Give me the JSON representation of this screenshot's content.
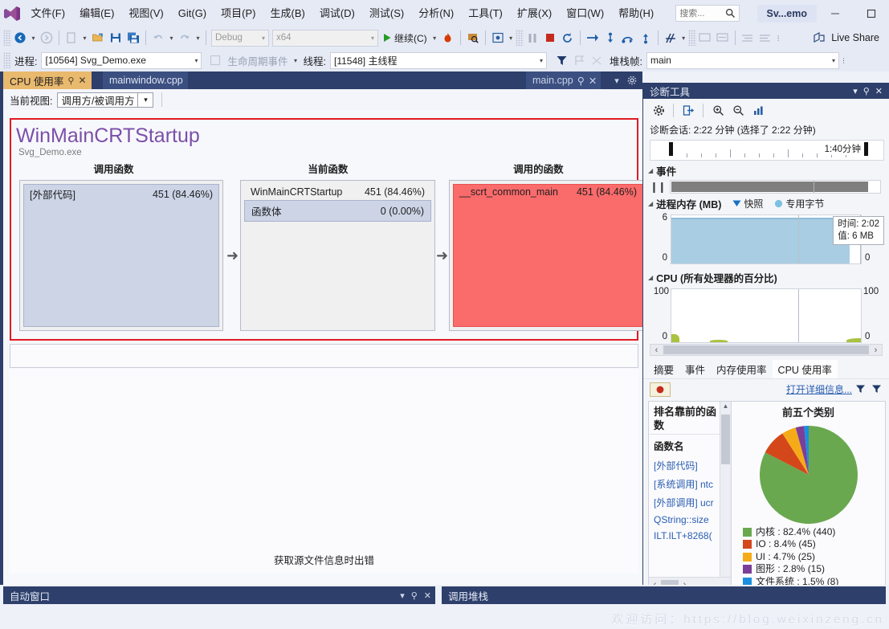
{
  "menu": {
    "logo_icon": "visual-studio-logo",
    "items": [
      "文件(F)",
      "编辑(E)",
      "视图(V)",
      "Git(G)",
      "项目(P)",
      "生成(B)",
      "调试(D)",
      "测试(S)",
      "分析(N)",
      "工具(T)",
      "扩展(X)",
      "窗口(W)",
      "帮助(H)"
    ],
    "search_placeholder": "搜索...",
    "search_value": "",
    "search_icon": "search-icon",
    "window_title": "Sv...emo",
    "minimize_icon": "minimize-icon",
    "maximize_icon": "maximize-icon"
  },
  "toolbar": {
    "nav_back_icon": "navigate-back-icon",
    "nav_forward_icon": "navigate-forward-icon",
    "new_item_icon": "new-item-icon",
    "open_icon": "open-file-icon",
    "save_icon": "save-icon",
    "save_all_icon": "save-all-icon",
    "undo_icon": "undo-icon",
    "redo_icon": "redo-icon",
    "config_value": "Debug",
    "platform_value": "x64",
    "continue_label": "继续(C)",
    "continue_icon": "play-icon",
    "hot_reload_icon": "hot-reload-icon",
    "attach_icon": "attach-to-process-icon",
    "break_all_icon": "break-all-icon",
    "pause_icon": "pause-icon",
    "stop_icon": "stop-debugging-icon",
    "restart_icon": "restart-icon",
    "show_next_icon": "show-next-statement-icon",
    "step_into_icon": "step-into-icon",
    "step_over_icon": "step-over-icon",
    "step_out_icon": "step-out-icon",
    "thread_icon": "threads-icon",
    "live_share_label": "Live Share",
    "live_share_icon": "live-share-icon"
  },
  "debugbar": {
    "process_label": "进程:",
    "process_value": "[10564] Svg_Demo.exe",
    "lifecycle_label": "生命周期事件",
    "lifecycle_icon": "lifecycle-events-icon",
    "thread_label": "线程:",
    "thread_value": "[11548] 主线程",
    "filter_icon": "filter-icon",
    "flag_icon": "flag-icon",
    "nocall_icon": "no-call-icon",
    "stackframe_label": "堆栈帧:",
    "stackframe_value": "main"
  },
  "doc_tabs": {
    "active": {
      "label": "CPU 使用率",
      "pin_icon": "pin-icon",
      "close_icon": "close-icon"
    },
    "inactive": {
      "label": "mainwindow.cpp"
    },
    "right": {
      "label": "main.cpp",
      "preview_icon": "preview-icon",
      "close_icon": "close-icon",
      "dropdown_icon": "chevron-down-icon",
      "settings_icon": "gear-icon"
    }
  },
  "viewbar": {
    "label": "当前视图:",
    "value": "调用方/被调用方",
    "dropdown_icon": "chevron-down-icon"
  },
  "calltree": {
    "title": "WinMainCRTStartup",
    "subtitle": "Svg_Demo.exe",
    "columns": [
      "调用函数",
      "当前函数",
      "调用的函数"
    ],
    "accent_color": "#e01b24",
    "callers": [
      {
        "name": "[外部代码]",
        "value": "451 (84.46%)"
      }
    ],
    "current": [
      {
        "name": "WinMainCRTStartup",
        "value": "451 (84.46%)"
      },
      {
        "name": "函数体",
        "value": "0 (0.00%)"
      }
    ],
    "callees": [
      {
        "name": "__scrt_common_main",
        "value": "451 (84.46%)"
      }
    ],
    "arrow_icon": "arrow-right-icon"
  },
  "source": {
    "message": "获取源文件信息时出错"
  },
  "diagnostics": {
    "title": "诊断工具",
    "dropdown_icon": "chevron-down-icon",
    "pin_icon": "pin-icon",
    "close_icon": "close-icon",
    "toolbar": {
      "settings_icon": "gear-icon",
      "export_icon": "export-icon",
      "zoom_in_icon": "zoom-in-icon",
      "zoom_out_icon": "zoom-out-icon",
      "reset_view_icon": "reset-zoom-icon"
    },
    "session_prefix": "诊断会话:",
    "session_duration": "2:22 分钟",
    "session_selected": "(选择了 2:22 分钟)",
    "session_line": "诊断会话: 2:22 分钟 (选择了 2:22 分钟)",
    "ruler_label": "1:40分钟",
    "events": {
      "title": "事件",
      "collapse_icon": "triangle-down-icon",
      "pause_icon": "pause-marker-icon"
    },
    "memory": {
      "title": "进程内存 (MB)",
      "legend_snapshot": "快照",
      "legend_snapshot_icon": "triangle-down-marker",
      "legend_private": "专用字节",
      "legend_private_icon": "circle-marker",
      "y_max": "6",
      "y_min": "0",
      "tooltip_time": "时间: 2:02",
      "tooltip_value": "值: 6 MB",
      "series_color": "#a9cde3"
    },
    "cpu": {
      "title": "CPU (所有处理器的百分比)",
      "y_max_left": "100",
      "y_min_left": "0",
      "y_max_right": "100",
      "y_min_right": "0",
      "series_color": "#a9c23f"
    },
    "scroll_left_icon": "chevron-left-icon",
    "scroll_right_icon": "chevron-right-icon",
    "tabs": [
      {
        "label": "摘要",
        "active": false
      },
      {
        "label": "事件",
        "active": false
      },
      {
        "label": "内存使用率",
        "active": false
      },
      {
        "label": "CPU 使用率",
        "active": true
      }
    ],
    "summary_bar": {
      "record_icon": "record-cpu-icon",
      "detail_link": "打开详细信息...",
      "filter_icon_1": "filter-icon",
      "filter_icon_2": "filter-icon"
    },
    "top_functions": {
      "heading": "排名靠前的函数",
      "column": "函数名",
      "items": [
        "[外部代码]",
        "[系统调用] ntc",
        "[外部调用] ucr",
        "QString::size",
        "ILT.ILT+8268("
      ],
      "scroll_up_icon": "chevron-up-icon",
      "scroll_down_icon": "chevron-down-icon",
      "hscroll_left_icon": "chevron-left-icon",
      "hscroll_right_icon": "chevron-right-icon"
    },
    "chart_data": {
      "type": "pie",
      "title": "前五个类别",
      "categories": [
        "内核",
        "IO",
        "UI",
        "图形",
        "文件系统"
      ],
      "values": [
        82.4,
        8.4,
        4.7,
        2.8,
        1.5
      ],
      "counts": [
        440,
        45,
        25,
        15,
        8
      ],
      "colors": [
        "#6aa84f",
        "#d4471b",
        "#f5ab17",
        "#7b3f98",
        "#1a8ee0"
      ],
      "legend": [
        {
          "label": "内核 : 82.4% (440)",
          "color": "#6aa84f"
        },
        {
          "label": "IO : 8.4% (45)",
          "color": "#d4471b"
        },
        {
          "label": "UI : 4.7% (25)",
          "color": "#f5ab17"
        },
        {
          "label": "图形 : 2.8% (15)",
          "color": "#7b3f98"
        },
        {
          "label": "文件系统 : 1.5% (8)",
          "color": "#1a8ee0"
        }
      ],
      "legend_position": "bottom-left"
    }
  },
  "bottom_dock": {
    "autos": {
      "label": "自动窗口",
      "dropdown_icon": "chevron-down-icon",
      "pin_icon": "pin-icon",
      "close_icon": "close-icon"
    },
    "callstack": {
      "label": "调用堆栈"
    }
  },
  "watermark": {
    "text": "欢迎访问：https://blog.weixinzeng.cn"
  }
}
